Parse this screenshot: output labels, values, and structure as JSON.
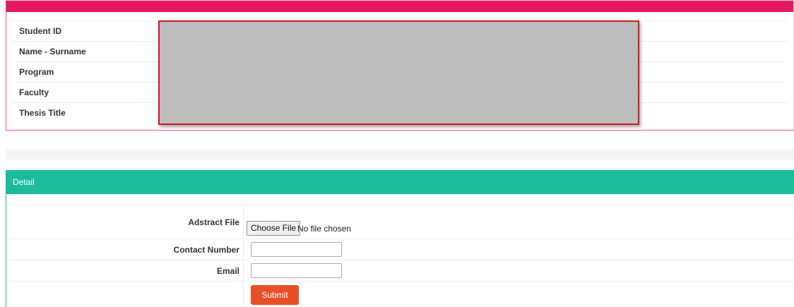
{
  "info_panel": {
    "header_text": "",
    "fields": [
      {
        "label": "Student ID"
      },
      {
        "label": "Name - Surname"
      },
      {
        "label": "Program"
      },
      {
        "label": "Faculty"
      },
      {
        "label": "Thesis Title"
      }
    ],
    "colors": {
      "header": "#e4175e",
      "redaction_fill": "#bdbdbd",
      "redaction_border": "#d1191f"
    }
  },
  "detail_panel": {
    "title": "Detail",
    "color": "#1bbc9b",
    "abstract_file": {
      "label": "Adstract File",
      "button_label": "Choose File",
      "status": "No file chosen"
    },
    "contact_number": {
      "label": "Contact Number",
      "value": ""
    },
    "email": {
      "label": "Email",
      "value": ""
    },
    "submit": {
      "label": "Submit",
      "color": "#e45127"
    }
  }
}
